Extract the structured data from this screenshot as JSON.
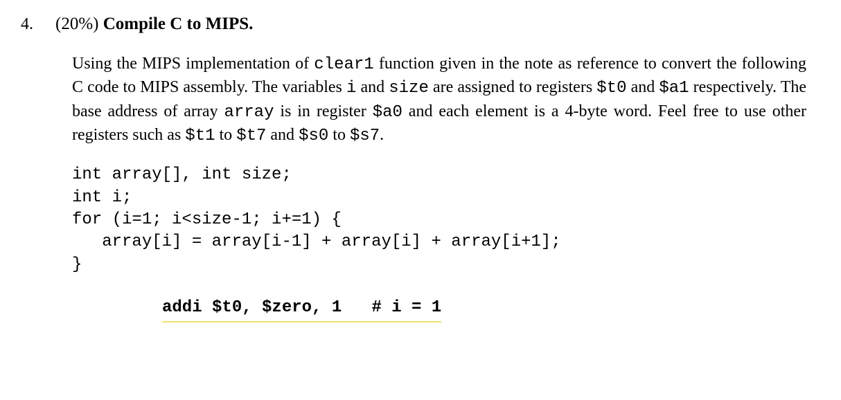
{
  "question": {
    "number": "4.",
    "percent": "(20%) ",
    "title": "Compile C to MIPS."
  },
  "paragraph": {
    "t1": "Using the MIPS implementation of ",
    "c1": "clear1",
    "t2": " function given in the note as reference to convert the following C code to MIPS assembly. The variables ",
    "c2": "i",
    "t3": " and  ",
    "c3": "size",
    "t4": " are assigned to registers ",
    "c4": "$t0",
    "t5": "  and  ",
    "c5": "$a1",
    "t6": " respectively. The base address of array ",
    "c6": "array",
    "t7": " is in register ",
    "c7": "$a0",
    "t8": " and each element is a 4-byte word. Feel free to use other registers such as ",
    "c8": "$t1",
    "t9": " to ",
    "c9": "$t7",
    "t10": " and ",
    "c10": "$s0",
    "t11": " to ",
    "c11": "$s7",
    "t12": "."
  },
  "code": "int array[], int size;\nint i;\nfor (i=1; i<size-1; i+=1) {\n   array[i] = array[i-1] + array[i] + array[i+1];\n}",
  "asm": {
    "line1": "addi $t0, $zero, 1   # i = 1"
  }
}
